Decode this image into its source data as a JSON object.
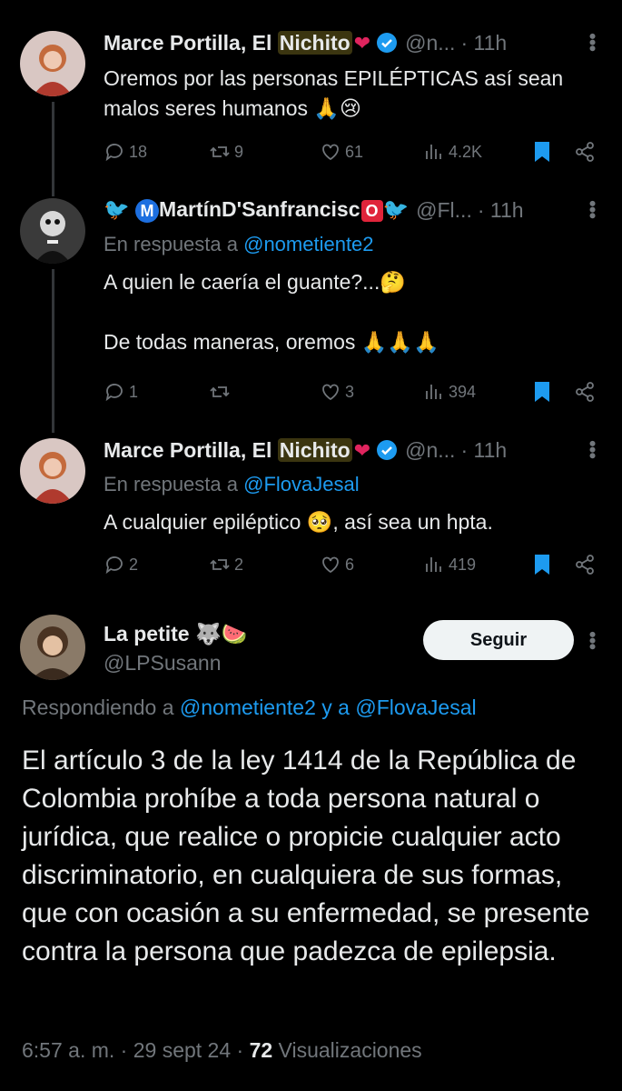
{
  "tweets": [
    {
      "name_prefix": "Marce Portilla, El ",
      "name_highlight": "Nichito",
      "name_emoji": "❤",
      "handle": "@n...",
      "time": "· 11h",
      "text": "Oremos por las personas EPILÉPTICAS así sean malos seres humanos 🙏😢",
      "replies": "18",
      "retweets": "9",
      "likes": "61",
      "views": "4.2K"
    },
    {
      "name": "🐦 Ⓜ️artínD'Sanfranciscⓞ🐦",
      "name_display": "MartínD'Sanfrancisc",
      "handle": "@Fl...",
      "time": "· 11h",
      "reply_label": "En respuesta a ",
      "reply_mention": "@nometiente2",
      "text_line1": "A quien le caería el guante?...🤔",
      "text_line2": "De todas maneras, oremos 🙏🙏🙏",
      "replies": "1",
      "retweets": "",
      "likes": "3",
      "views": "394"
    },
    {
      "name_prefix": "Marce Portilla, El ",
      "name_highlight": "Nichito",
      "name_emoji": "❤",
      "handle": "@n...",
      "time": "· 11h",
      "reply_label": "En respuesta a ",
      "reply_mention": "@FlovaJesal",
      "text": "A cualquier epiléptico 🥺, así sea un hpta.",
      "replies": "2",
      "retweets": "2",
      "likes": "6",
      "views": "419"
    }
  ],
  "main": {
    "name": "La petite 🐺🍉",
    "handle": "@LPSusann",
    "follow_label": "Seguir",
    "replying_label": "Respondiendo a ",
    "replying_mention1": "@nometiente2",
    "replying_and": " y a ",
    "replying_mention2": "@FlovaJesal",
    "text": "El artículo 3 de la ley 1414 de la República de Colombia prohíbe a toda persona natural o jurídica, que realice o propicie cualquier acto discriminatorio, en cualquiera de sus formas, que con ocasión a su enfermedad, se presente contra la persona que padezca de epilepsia.",
    "time": "6:57 a. m. · 29 sept 24 · ",
    "views_count": "72",
    "views_label": " Visualizaciones"
  },
  "colors": {
    "accent": "#1d9bf0",
    "muted": "#71767b",
    "highlight": "#3b3510",
    "heart": "#e0245e"
  }
}
